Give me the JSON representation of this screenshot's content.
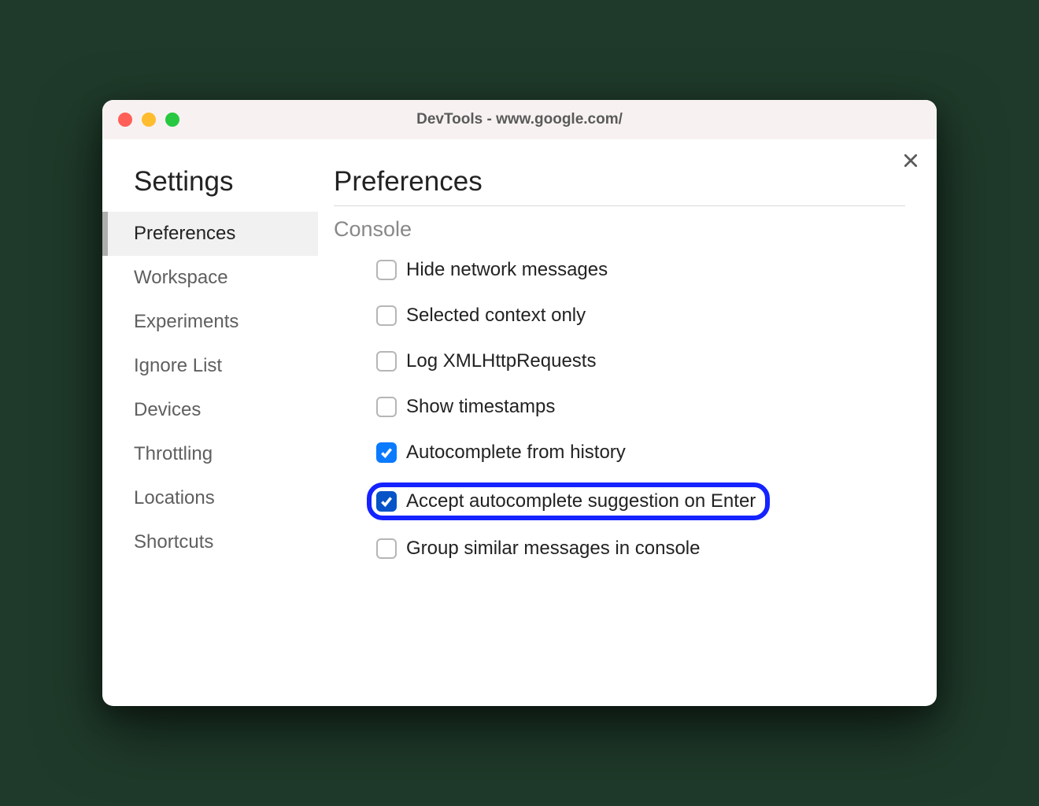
{
  "window": {
    "title": "DevTools - www.google.com/"
  },
  "sidebar": {
    "title": "Settings",
    "items": [
      {
        "label": "Preferences",
        "selected": true
      },
      {
        "label": "Workspace",
        "selected": false
      },
      {
        "label": "Experiments",
        "selected": false
      },
      {
        "label": "Ignore List",
        "selected": false
      },
      {
        "label": "Devices",
        "selected": false
      },
      {
        "label": "Throttling",
        "selected": false
      },
      {
        "label": "Locations",
        "selected": false
      },
      {
        "label": "Shortcuts",
        "selected": false
      }
    ]
  },
  "main": {
    "title": "Preferences",
    "section": "Console",
    "options": [
      {
        "label": "Hide network messages",
        "checked": false,
        "highlighted": false
      },
      {
        "label": "Selected context only",
        "checked": false,
        "highlighted": false
      },
      {
        "label": "Log XMLHttpRequests",
        "checked": false,
        "highlighted": false
      },
      {
        "label": "Show timestamps",
        "checked": false,
        "highlighted": false
      },
      {
        "label": "Autocomplete from history",
        "checked": true,
        "highlighted": false
      },
      {
        "label": "Accept autocomplete suggestion on Enter",
        "checked": true,
        "highlighted": true
      },
      {
        "label": "Group similar messages in console",
        "checked": false,
        "highlighted": false
      }
    ]
  }
}
